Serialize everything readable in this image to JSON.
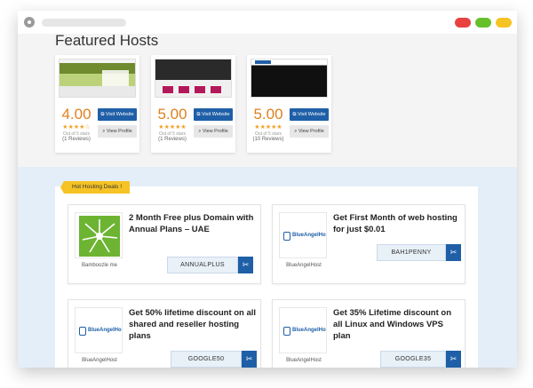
{
  "featured": {
    "title": "Featured Hosts",
    "hosts": [
      {
        "score": "4.00",
        "stars": "★★★★☆",
        "out_of": "Out of 5 stars",
        "reviews": "(1 Reviews)",
        "visit_label": "Visit Website",
        "profile_label": "View Profile"
      },
      {
        "score": "5.00",
        "stars": "★★★★★",
        "out_of": "Out of 5 stars",
        "reviews": "(1 Reviews)",
        "visit_label": "Visit Website",
        "profile_label": "View Profile"
      },
      {
        "score": "5.00",
        "stars": "★★★★★",
        "out_of": "Out of 5 stars",
        "reviews": "(10 Reviews)",
        "visit_label": "Visit Website",
        "profile_label": "View Profile"
      }
    ]
  },
  "deals": {
    "ribbon": "Hot Hosting Deals !",
    "items": [
      {
        "text": "2 Month Free plus Domain with Annual Plans – UAE",
        "code": "ANNUALPLUS",
        "host": "Bamboozle me",
        "logo": "bamboozle-star"
      },
      {
        "text": "Get First Month of web hosting for just $0.01",
        "code": "BAH1PENNY",
        "host": "BlueAngelHost",
        "logo": "blueangelhost"
      },
      {
        "text": "Get 50% lifetime discount on all shared and reseller hosting plans",
        "code": "GOOGLE50",
        "host": "BlueAngelHost",
        "logo": "blueangelhost"
      },
      {
        "text": "Get 35% Lifetime discount on all Linux and Windows VPS plan",
        "code": "GOOGLE35",
        "host": "BlueAngelHost",
        "logo": "blueangelhost"
      }
    ]
  },
  "icons": {
    "visit": "external-link-icon",
    "profile": "search-icon",
    "code": "scissors-icon"
  },
  "colors": {
    "accent": "#1f5fa7",
    "rating": "#e0801c",
    "ribbon": "#f6c325",
    "band": "#e4eef8"
  }
}
